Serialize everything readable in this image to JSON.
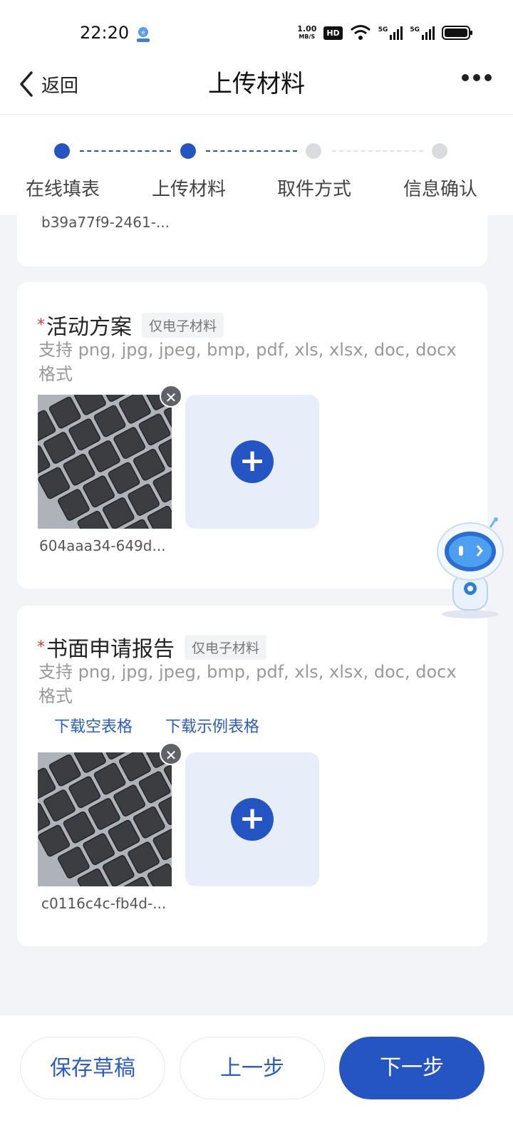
{
  "status_bar": {
    "time": "22:20",
    "net_speed_value": "1.00",
    "net_speed_unit": "MB/S",
    "hd_badge": "HD",
    "sim1_label": "5G",
    "sim2_label": "5G"
  },
  "nav": {
    "back_label": "返回",
    "title": "上传材料"
  },
  "steps": [
    {
      "label": "在线填表",
      "state": "done"
    },
    {
      "label": "上传材料",
      "state": "active"
    },
    {
      "label": "取件方式",
      "state": "pending"
    },
    {
      "label": "信息确认",
      "state": "pending"
    }
  ],
  "colors": {
    "primary": "#2455c3",
    "step_pending": "#d9dbe0",
    "required_star": "#e53935",
    "link": "#2b5cc7"
  },
  "material_prev": {
    "filename": "b39a77f9-2461-..."
  },
  "material_1": {
    "required_mark": "*",
    "title": "活动方案",
    "tag": "仅电子材料",
    "hint": "支持 png, jpg, jpeg, bmp, pdf, xls, xlsx, doc, docx 格式",
    "filename": "604aaa34-649d..."
  },
  "material_2": {
    "required_mark": "*",
    "title": "书面申请报告",
    "tag": "仅电子材料",
    "hint": "支持 png, jpg, jpeg, bmp, pdf, xls, xlsx, doc, docx 格式",
    "download_blank": "下载空表格",
    "download_example": "下载示例表格",
    "filename": "c0116c4c-fb4d-..."
  },
  "bottom": {
    "save_draft": "保存草稿",
    "prev": "上一步",
    "next": "下一步"
  }
}
